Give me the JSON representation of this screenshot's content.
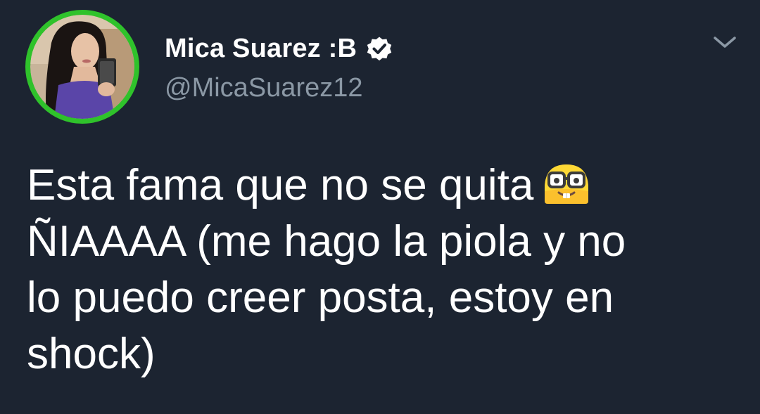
{
  "tweet": {
    "author": {
      "display_name": "Mica Suarez :B",
      "handle": "@MicaSuarez12",
      "verified": true,
      "avatar_ring_color": "#2fc22b"
    },
    "text_lines": [
      "Esta fama que no se quita",
      "ÑIAAAA (me hago la piola y no",
      "lo puedo creer posta, estoy en",
      "shock)"
    ],
    "emoji": "nerd-face-emoji",
    "menu_icon": "chevron-down-icon"
  },
  "colors": {
    "background": "#1c2431",
    "text": "#ffffff",
    "secondary_text": "#8b98a5",
    "verified_badge": "#ffffff"
  }
}
